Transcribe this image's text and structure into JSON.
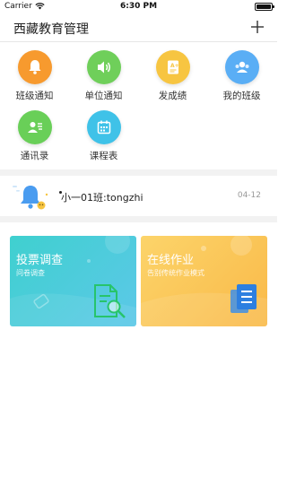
{
  "status_bar": {
    "carrier": "Carrier",
    "time": "6:30 PM"
  },
  "header": {
    "title": "西藏教育管理"
  },
  "icons": [
    {
      "label": "班级通知",
      "icon": "bell-icon",
      "color": "#f79a2e"
    },
    {
      "label": "单位通知",
      "icon": "speaker-icon",
      "color": "#6fcf5a"
    },
    {
      "label": "发成绩",
      "icon": "grade-sheet-icon",
      "color": "#f7c541"
    },
    {
      "label": "我的班级",
      "icon": "class-people-icon",
      "color": "#5aaef5"
    },
    {
      "label": "通讯录",
      "icon": "contacts-icon",
      "color": "#69cf58"
    },
    {
      "label": "课程表",
      "icon": "calendar-icon",
      "color": "#3fc2e8"
    }
  ],
  "notice": {
    "text": "小一01班:tongzhi",
    "date": "04-12"
  },
  "cards": [
    {
      "title": "投票调查",
      "subtitle": "问卷调查",
      "icon": "survey-magnifier-icon",
      "color": "#4dcfd8"
    },
    {
      "title": "在线作业",
      "subtitle": "告别传统作业模式",
      "icon": "homework-book-icon",
      "color": "#fbc64d"
    }
  ]
}
